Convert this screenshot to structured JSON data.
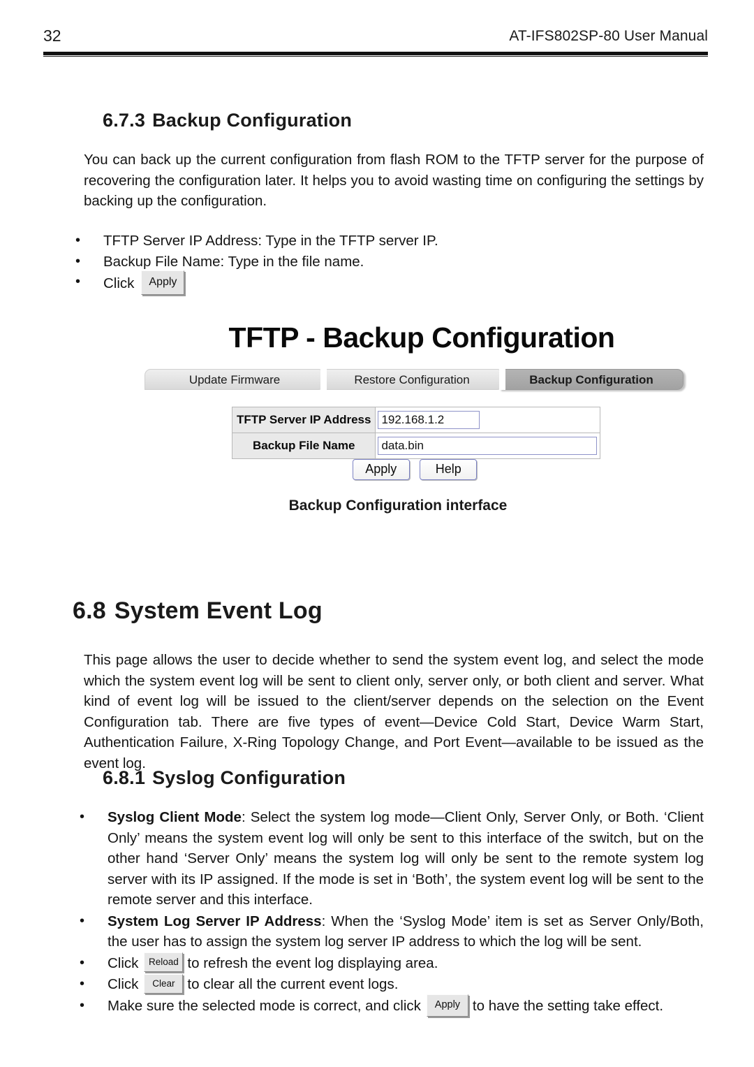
{
  "page": {
    "number": "32",
    "manual_title": "AT-IFS802SP-80 User Manual"
  },
  "section_673": {
    "number": "6.7.3",
    "title": "Backup Configuration",
    "paragraph": "You can back up the current configuration from flash ROM to the TFTP server for the purpose of recovering the configuration later. It helps you to avoid wasting time on configuring the settings by backing up the configuration.",
    "bullets": [
      "TFTP Server IP Address: Type in the TFTP server IP.",
      "Backup File Name: Type in the file name."
    ],
    "click_label": "Click",
    "apply_button_label": "Apply"
  },
  "figure": {
    "title": "TFTP - Backup Configuration",
    "tabs": [
      {
        "label": "Update Firmware",
        "active": false
      },
      {
        "label": "Restore Configuration",
        "active": false
      },
      {
        "label": "Backup Configuration",
        "active": true
      }
    ],
    "fields": [
      {
        "label": "TFTP Server IP Address",
        "value": "192.168.1.2"
      },
      {
        "label": "Backup File Name",
        "value": "data.bin"
      }
    ],
    "buttons": [
      {
        "label": "Apply"
      },
      {
        "label": "Help"
      }
    ],
    "caption": "Backup Configuration interface"
  },
  "section_68": {
    "number": "6.8",
    "title": "System Event Log",
    "paragraph": "This page allows the user to decide whether to send the system event log, and select the mode which the system event log will be sent to client only, server only, or both client and server. What kind of event log will be issued to the client/server depends on the selection on the Event Configuration tab. There are five types of event—Device Cold Start, Device Warm Start, Authentication Failure, X-Ring Topology Change, and Port Event—available to be issued as the event log."
  },
  "section_681": {
    "number": "6.8.1",
    "title": "Syslog Configuration",
    "bullet_syslog_client_mode": {
      "label": "Syslog Client Mode",
      "text": ": Select the system log mode—Client Only, Server Only, or Both. ‘Client Only’ means the system event log will only be sent to this interface of the switch, but on the other hand ‘Server Only’ means the system log will only be sent to the remote system log server with its IP assigned. If the mode is set in ‘Both’, the system event log will be sent to the remote server and this interface."
    },
    "bullet_system_log_server_ip": {
      "label": "System Log Server IP Address",
      "text": ": When the ‘Syslog Mode’ item is set as Server Only/Both, the user has to assign the system log server IP address to which the log will be sent."
    },
    "bullet_reload": {
      "prefix": "Click",
      "button_label": "Reload",
      "suffix": "to refresh the event log displaying area."
    },
    "bullet_clear": {
      "prefix": "Click",
      "button_label": "Clear",
      "suffix": "to clear all the current event logs."
    },
    "bullet_apply": {
      "prefix": "Make sure the selected mode is correct, and click",
      "button_label": "Apply",
      "suffix": "to have the setting take effect."
    }
  }
}
